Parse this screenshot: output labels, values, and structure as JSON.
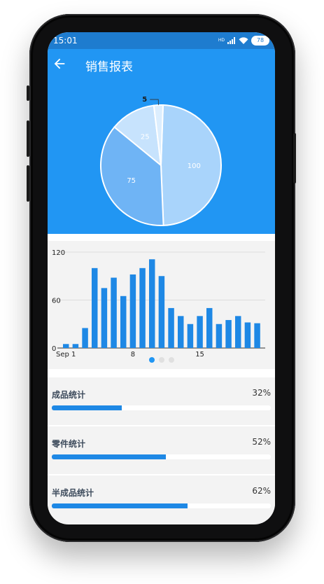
{
  "status_bar": {
    "time": "15:01",
    "network_tag": "HD",
    "battery": "78",
    "icons": [
      "signal-icon",
      "wifi-icon",
      "battery-icon"
    ]
  },
  "header": {
    "title": "销售报表",
    "back_icon": "arrow-left-icon",
    "color": "#2196f3"
  },
  "pie": {
    "slices": [
      {
        "label": "100",
        "value": 100,
        "color": "#a9d4fb"
      },
      {
        "label": "75",
        "value": 75,
        "color": "#6fb4f5"
      },
      {
        "label": "25",
        "value": 25,
        "color": "#c7e3fd"
      },
      {
        "label": "5",
        "value": 5,
        "color": "#dceefe"
      }
    ]
  },
  "chart_data": {
    "type": "bar",
    "x": [
      1,
      2,
      3,
      4,
      5,
      6,
      7,
      8,
      9,
      10,
      11,
      12,
      13,
      14,
      15,
      16,
      17,
      18,
      19,
      20,
      21
    ],
    "values": [
      5,
      5,
      25,
      100,
      75,
      88,
      65,
      92,
      100,
      111,
      90,
      50,
      40,
      30,
      40,
      50,
      30,
      35,
      40,
      32,
      31
    ],
    "x_tick_labels": [
      "Sep 1",
      "8",
      "15"
    ],
    "y_tick_labels": [
      "0",
      "60",
      "120"
    ],
    "ylim": [
      0,
      120
    ],
    "grid": true,
    "color": "#1e88e5"
  },
  "pager": {
    "pages": 3,
    "active": 0
  },
  "stats": [
    {
      "label": "成品统计",
      "percent_text": "32%",
      "fraction": 0.32
    },
    {
      "label": "零件统计",
      "percent_text": "52%",
      "fraction": 0.52
    },
    {
      "label": "半成品统计",
      "percent_text": "62%",
      "fraction": 0.62
    }
  ]
}
